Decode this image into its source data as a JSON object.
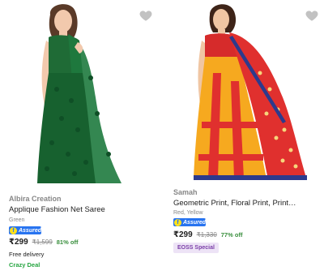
{
  "products": [
    {
      "brand": "Albira Creation",
      "title": "Applique Fashion Net Saree",
      "color": "Green",
      "assured": "Assured",
      "assured_badge": "f",
      "price": "₹299",
      "mrp": "₹1,599",
      "discount": "81% off",
      "delivery": "Free delivery",
      "deal": "Crazy Deal",
      "wishlist_icon": "heart-icon",
      "image_alt": "green saree with applique"
    },
    {
      "brand": "Samah",
      "title": "Geometric Print, Floral Print, Print…",
      "color": "Red, Yellow",
      "assured": "Assured",
      "assured_badge": "f",
      "price": "₹299",
      "mrp": "₹1,330",
      "discount": "77% off",
      "tag": "EOSS Special",
      "wishlist_icon": "heart-icon",
      "image_alt": "red and yellow printed saree"
    }
  ],
  "colors": {
    "price_green": "#388e3c",
    "assured_blue": "#2874f0",
    "deal_green": "#26a541",
    "eoss_purple": "#7b3fa8"
  }
}
